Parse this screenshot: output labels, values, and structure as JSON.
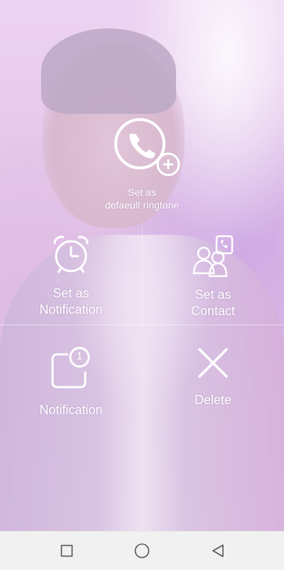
{
  "menu": {
    "ringtone": {
      "line1": "Set as",
      "line2": "defaeult ringtone",
      "icon": "phone-plus-icon"
    },
    "notification_set": {
      "line1": "Set as",
      "line2": "Notification",
      "icon": "alarm-clock-icon"
    },
    "contact": {
      "line1": "Set as",
      "line2": "Contact",
      "icon": "contacts-icon"
    },
    "notification": {
      "label": "Notification",
      "badge": "1",
      "icon": "notification-badge-icon"
    },
    "delete": {
      "label": "Delete",
      "icon": "close-icon"
    }
  },
  "navigation": {
    "recents": "square-icon",
    "home": "circle-icon",
    "back": "triangle-back-icon"
  }
}
